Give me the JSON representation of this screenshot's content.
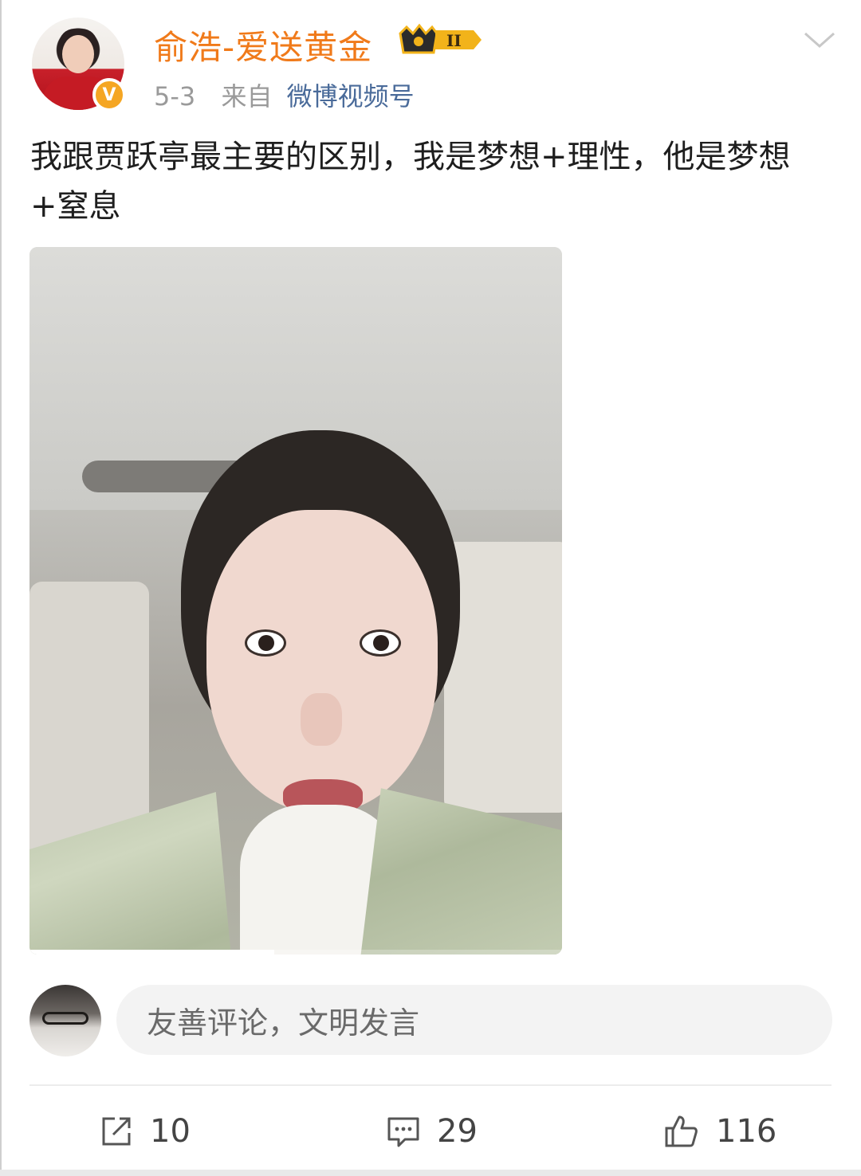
{
  "post": {
    "username": "俞浩-爱送黄金",
    "vip_level": "II",
    "date": "5-3",
    "from_label": "来自",
    "source": "微博视频号",
    "text": "我跟贾跃亭最主要的区别，我是梦想+理性，他是梦想+窒息"
  },
  "video": {
    "progress_fraction": 0.46
  },
  "comment_box": {
    "placeholder": "友善评论，文明发言"
  },
  "actions": {
    "repost_count": "10",
    "comment_count": "29",
    "like_count": "116"
  },
  "icons": {
    "verified": "verified-v-icon",
    "vip": "crown-vip-icon",
    "menu": "chevron-down-icon",
    "repost": "share-icon",
    "comment": "comment-icon",
    "like": "thumbs-up-icon"
  },
  "colors": {
    "username": "#f07a1a",
    "source_link": "#4a6b9a",
    "verified_badge": "#f5a623"
  }
}
